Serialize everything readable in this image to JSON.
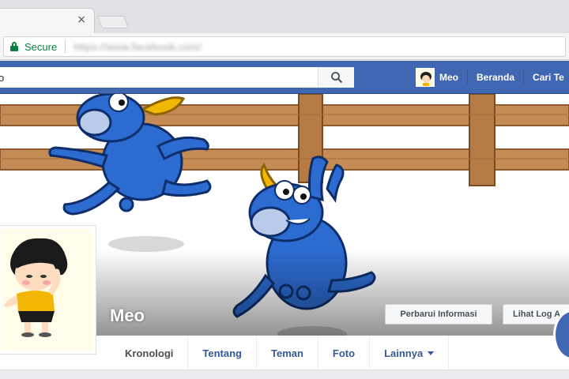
{
  "browser": {
    "tab_close_glyph": "×",
    "secure_label": "Secure",
    "url": "https://www.facebook.com/"
  },
  "fb_header": {
    "search_value": "o",
    "user_name": "Meo",
    "nav_home": "Beranda",
    "nav_find": "Cari Te"
  },
  "profile": {
    "name": "Meo",
    "update_info_button": "Perbarui Informasi",
    "activity_log_button": "Lihat Log A"
  },
  "tabs": [
    {
      "label": "Kronologi"
    },
    {
      "label": "Tentang"
    },
    {
      "label": "Teman"
    },
    {
      "label": "Foto"
    },
    {
      "label": "Lainnya"
    }
  ],
  "colors": {
    "facebook_blue": "#4267b2",
    "secure_green": "#0b8043",
    "bull_blue": "#2c6bd0",
    "fence_brown": "#c68a55"
  },
  "icons": {
    "lock": "lock-icon",
    "search": "search-icon",
    "dropdown": "caret-down-icon"
  }
}
